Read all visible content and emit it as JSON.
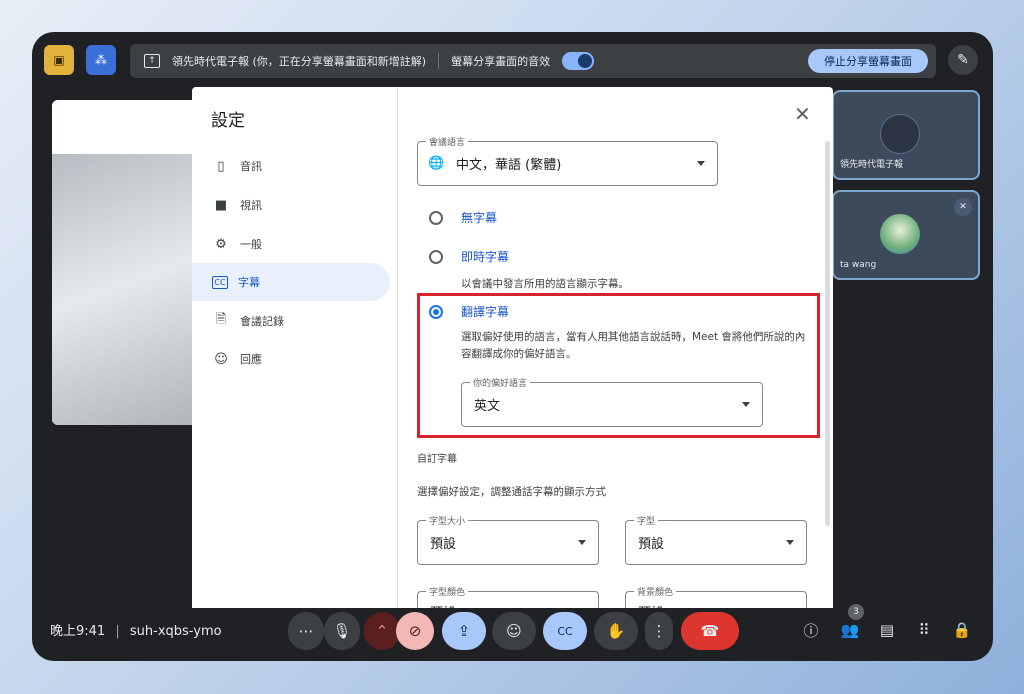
{
  "topbar": {
    "share_text": "領先時代電子報 (你，正在分享螢幕畫面和新增註解)",
    "audio_text": "螢幕分享畫面的音效",
    "stop_label": "停止分享螢幕畫面"
  },
  "tiles": [
    {
      "name": "領先時代電子報"
    },
    {
      "name": "ta wang"
    }
  ],
  "bottombar": {
    "time": "晚上9:41",
    "divider": "|",
    "code": "suh-xqbs-ymo",
    "people_count": "3"
  },
  "dialog": {
    "title": "設定",
    "nav": [
      {
        "label": "音訊",
        "icon": "speaker-icon"
      },
      {
        "label": "視訊",
        "icon": "video-camera-icon"
      },
      {
        "label": "一般",
        "icon": "gear-icon"
      },
      {
        "label": "字幕",
        "icon": "captions-icon"
      },
      {
        "label": "會議記錄",
        "icon": "document-download-icon"
      },
      {
        "label": "回應",
        "icon": "smiley-icon"
      }
    ],
    "meeting_language": {
      "label": "會議語言",
      "value": "中文，華語 (繁體)"
    },
    "options": {
      "none": "無字幕",
      "live": "即時字幕",
      "live_desc": "以會議中發言所用的語言顯示字幕。",
      "translate": "翻譯字幕",
      "translate_desc": "選取偏好使用的語言，當有人用其他語言說話時，Meet 會將他們所說的內容翻譯成你的偏好語言。"
    },
    "preferred_language": {
      "label": "你的偏好語言",
      "value": "英文"
    },
    "custom": {
      "heading": "自訂字幕",
      "desc": "選擇偏好設定，調整通話字幕的顯示方式",
      "font_size": {
        "label": "字型大小",
        "value": "預設"
      },
      "font": {
        "label": "字型",
        "value": "預設"
      },
      "font_color": {
        "label": "字型顏色",
        "value": "預設"
      },
      "bg_color": {
        "label": "背景顏色",
        "value": "預設"
      }
    }
  }
}
